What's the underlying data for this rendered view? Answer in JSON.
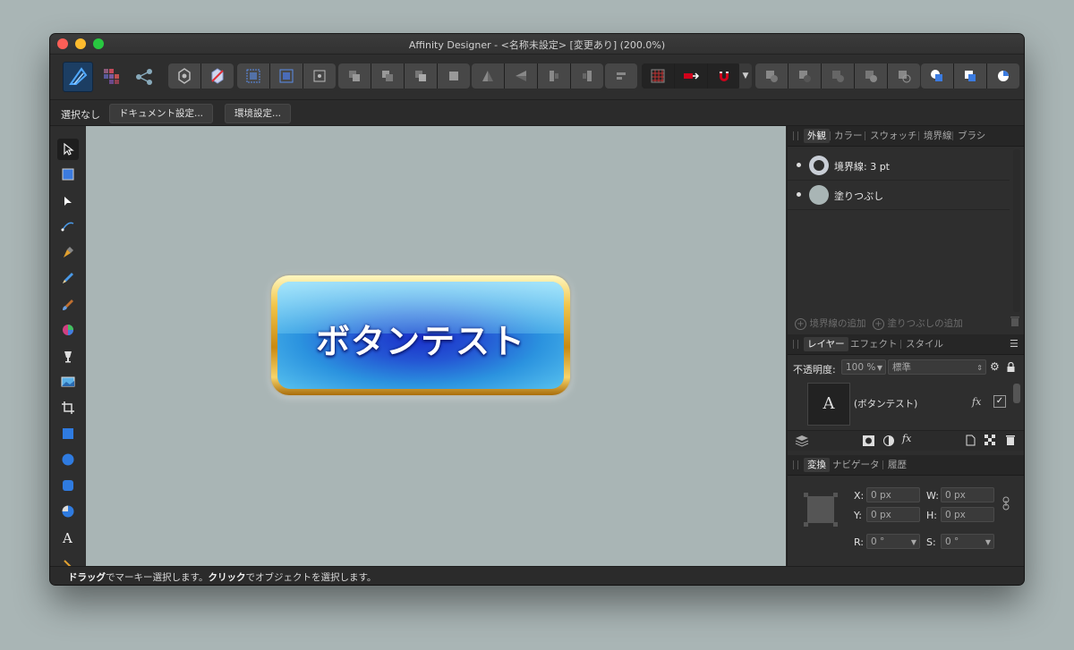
{
  "window": {
    "title": "Affinity Designer - <名称未設定> [変更あり] (200.0%)"
  },
  "context_bar": {
    "selection_label": "選択なし",
    "document_setup": "ドキュメント設定...",
    "preferences": "環境設定..."
  },
  "canvas": {
    "button_text": "ボタンテスト"
  },
  "appearance_panel": {
    "tabs": [
      "外観",
      "カラー",
      "スウォッチ",
      "境界線",
      "ブラシ"
    ],
    "rows": [
      {
        "label": "境界線: 3 pt"
      },
      {
        "label": "塗りつぶし"
      }
    ],
    "add_stroke": "境界線の追加",
    "add_fill": "塗りつぶしの追加"
  },
  "layers_panel": {
    "tabs": [
      "レイヤー",
      "エフェクト",
      "スタイル"
    ],
    "opacity_label": "不透明度:",
    "opacity_value": "100 %",
    "blend_mode": "標準",
    "layer_name": "(ボタンテスト)",
    "thumb_glyph": "A",
    "fx_label": "fx"
  },
  "transform_panel": {
    "tabs": [
      "変換",
      "ナビゲータ",
      "履歴"
    ],
    "x_label": "X:",
    "x_value": "0 px",
    "y_label": "Y:",
    "y_value": "0 px",
    "w_label": "W:",
    "w_value": "0 px",
    "h_label": "H:",
    "h_value": "0 px",
    "r_label": "R:",
    "r_value": "0 °",
    "s_label": "S:",
    "s_value": "0 °"
  },
  "status": {
    "drag": "ドラッグ",
    "drag_rest": "でマーキー選択します。",
    "click": "クリック",
    "click_rest": "でオブジェクトを選択します。"
  },
  "colors": {
    "ui_bg": "#2e2e2e",
    "canvas_bg": "#a9b5b5",
    "accent_red": "#d0021b",
    "button_blue": "#2456d4",
    "button_gold": "#f1c54a"
  }
}
